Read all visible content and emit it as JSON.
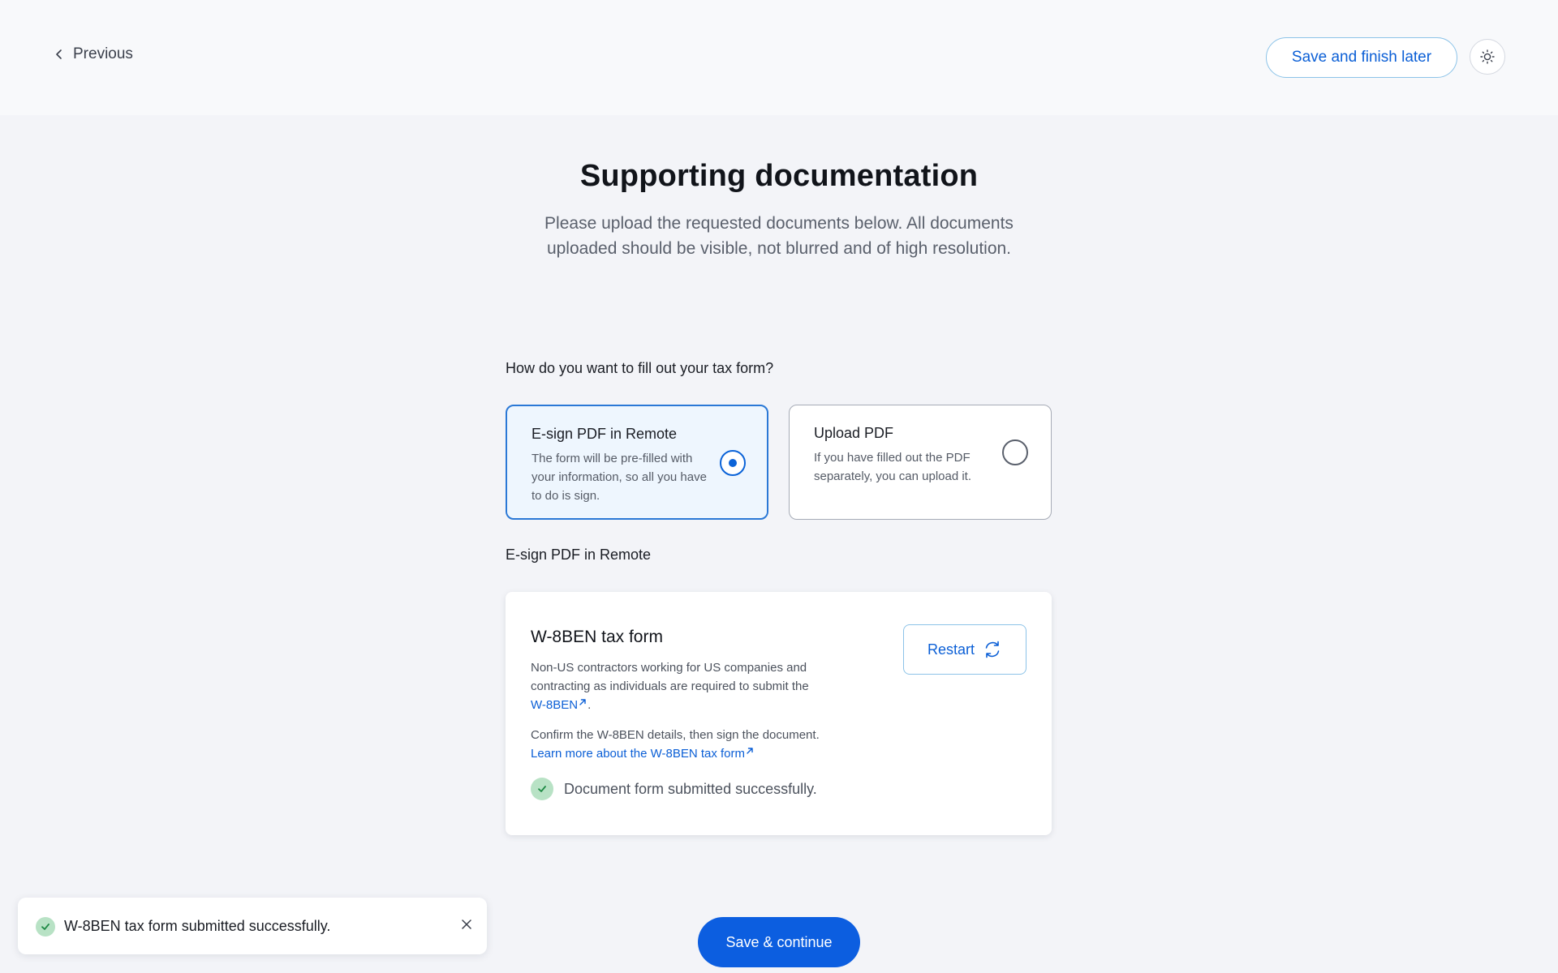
{
  "header": {
    "previous_label": "Previous",
    "save_later_label": "Save and finish later",
    "theme_icon": "sun-icon"
  },
  "page": {
    "title": "Supporting documentation",
    "subtitle": "Please upload the requested documents below. All documents uploaded should be visible, not blurred and of high resolution."
  },
  "tax_form": {
    "question": "How do you want to fill out your tax form?",
    "options": [
      {
        "title": "E-sign PDF in Remote",
        "description": "The form will be pre-filled with your information, so all you have to do is sign.",
        "selected": true
      },
      {
        "title": "Upload PDF",
        "description": "If you have filled out the PDF separately, you can upload it.",
        "selected": false
      }
    ],
    "section_label": "E-sign PDF in Remote"
  },
  "document": {
    "title": "W-8BEN tax form",
    "description": "Non-US contractors working for US companies and contracting as individuals are required to submit the",
    "link_label": "W-8BEN",
    "link_suffix": ".",
    "confirm_text": "Confirm the W-8BEN details, then sign the document.",
    "learn_more_label": "Learn more about the W-8BEN tax form",
    "status_text": "Document form submitted successfully.",
    "restart_label": "Restart"
  },
  "footer": {
    "primary_label": "Save & continue"
  },
  "toast": {
    "message": "W-8BEN tax form submitted successfully."
  },
  "colors": {
    "accent": "#0c5ee0",
    "success_bg": "#b8e2c5",
    "success_check": "#1f8a45",
    "selected_card_bg": "#eef6fe"
  }
}
